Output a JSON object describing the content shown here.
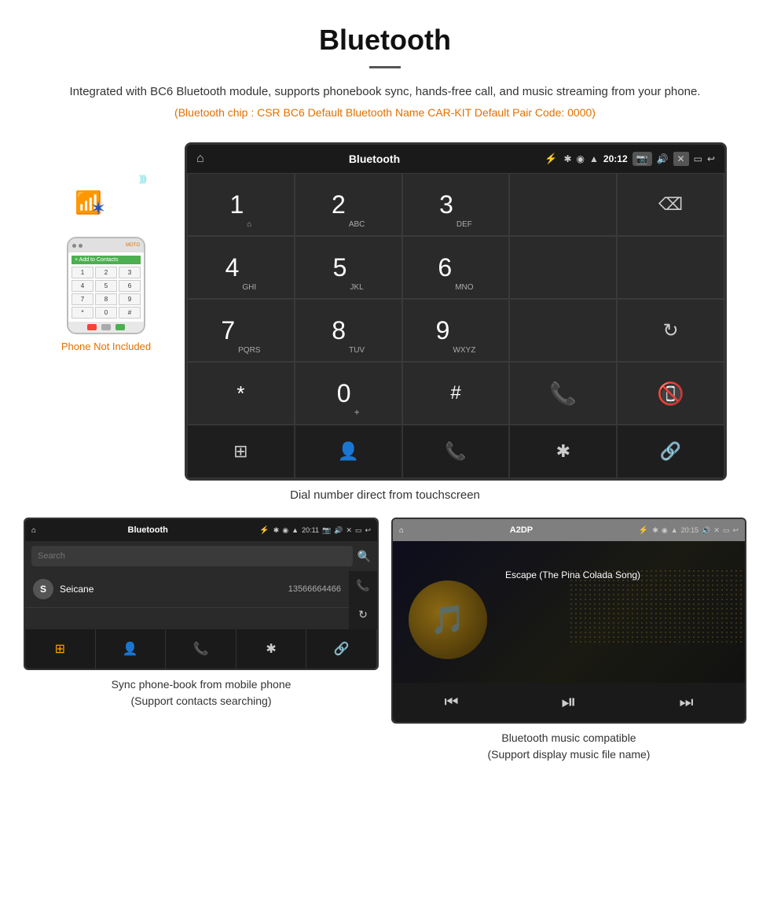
{
  "header": {
    "title": "Bluetooth",
    "description": "Integrated with BC6 Bluetooth module, supports phonebook sync, hands-free call, and music streaming from your phone.",
    "specs": "(Bluetooth chip : CSR BC6    Default Bluetooth Name CAR-KIT    Default Pair Code: 0000)"
  },
  "phone_mockup": {
    "not_included_label": "Phone Not Included",
    "keys": [
      "1",
      "2",
      "3",
      "4",
      "5",
      "6",
      "7",
      "8",
      "9",
      "*",
      "0",
      "#"
    ]
  },
  "dial_screen": {
    "status_bar": {
      "title": "Bluetooth",
      "time": "20:12"
    },
    "keys": [
      {
        "main": "1",
        "sub": "⌂"
      },
      {
        "main": "2",
        "sub": "ABC"
      },
      {
        "main": "3",
        "sub": "DEF"
      },
      {
        "main": "",
        "sub": ""
      },
      {
        "main": "⌫",
        "sub": ""
      },
      {
        "main": "4",
        "sub": "GHI"
      },
      {
        "main": "5",
        "sub": "JKL"
      },
      {
        "main": "6",
        "sub": "MNO"
      },
      {
        "main": "",
        "sub": ""
      },
      {
        "main": "",
        "sub": ""
      },
      {
        "main": "7",
        "sub": "PQRS"
      },
      {
        "main": "8",
        "sub": "TUV"
      },
      {
        "main": "9",
        "sub": "WXYZ"
      },
      {
        "main": "",
        "sub": ""
      },
      {
        "main": "↻",
        "sub": ""
      },
      {
        "main": "*",
        "sub": ""
      },
      {
        "main": "0",
        "sub": "+"
      },
      {
        "main": "#",
        "sub": ""
      },
      {
        "main": "📞",
        "sub": ""
      },
      {
        "main": "📵",
        "sub": ""
      }
    ],
    "nav_icons": [
      "⊞",
      "👤",
      "📞",
      "✱",
      "🔗"
    ],
    "caption": "Dial number direct from touchscreen"
  },
  "phonebook_screen": {
    "status_bar": {
      "title": "Bluetooth",
      "time": "20:11"
    },
    "search_placeholder": "Search",
    "contacts": [
      {
        "initial": "S",
        "name": "Seicane",
        "number": "13566664466"
      }
    ],
    "nav_icons": [
      "⊞",
      "👤",
      "📞",
      "✱",
      "🔗"
    ],
    "caption_line1": "Sync phone-book from mobile phone",
    "caption_line2": "(Support contacts searching)"
  },
  "music_screen": {
    "status_bar": {
      "title": "A2DP",
      "time": "20:15"
    },
    "song_title": "Escape (The Pina Colada Song)",
    "controls": [
      "⏮",
      "⏯",
      "⏭"
    ],
    "caption_line1": "Bluetooth music compatible",
    "caption_line2": "(Support display music file name)"
  }
}
